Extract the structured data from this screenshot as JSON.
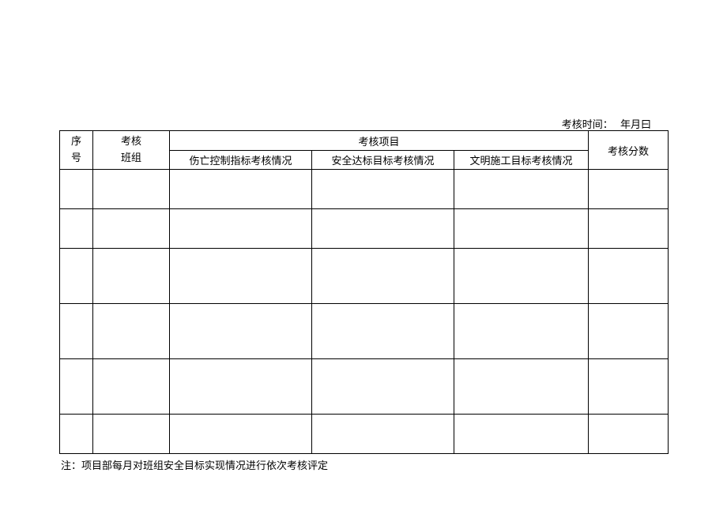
{
  "header": {
    "timestamp_label": "考核时间：",
    "timestamp_value": "年月曰"
  },
  "table": {
    "col_seq_line1": "序",
    "col_seq_line2": "号",
    "col_team_line1": "考核",
    "col_team_line2": "班组",
    "col_items_header": "考核项目",
    "col_item1": "伤亡控制指标考核情况",
    "col_item2": "安全达标目标考核情况",
    "col_item3": "文明施工目标考核情况",
    "col_score": "考核分数"
  },
  "note": "注：项目部每月对班组安全目标实现情况进行依次考核评定"
}
